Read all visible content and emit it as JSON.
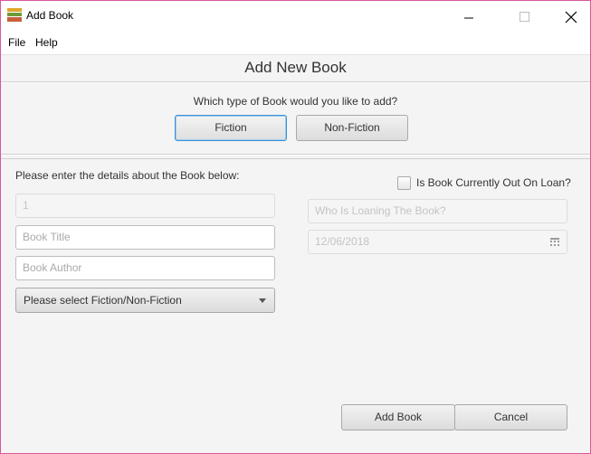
{
  "window": {
    "title": "Add Book"
  },
  "menubar": {
    "items": [
      "File",
      "Help"
    ]
  },
  "header": {
    "title": "Add New Book"
  },
  "type_select": {
    "question": "Which type of Book would you like to add?",
    "fiction_label": "Fiction",
    "nonfiction_label": "Non-Fiction"
  },
  "details": {
    "prompt": "Please enter the details about the Book below:",
    "id_value": "1",
    "title_placeholder": "Book Title",
    "author_placeholder": "Book Author",
    "genre_selected": "Please select Fiction/Non-Fiction"
  },
  "loan": {
    "checkbox_label": "Is Book Currently Out On Loan?",
    "checked": false,
    "borrower_placeholder": "Who Is Loaning The Book?",
    "date_value": "12/06/2018"
  },
  "actions": {
    "add_label": "Add Book",
    "cancel_label": "Cancel"
  },
  "icons": {
    "app": "books-icon",
    "minimize": "minimize-icon",
    "maximize": "maximize-icon",
    "close": "close-icon",
    "calendar": "calendar-icon",
    "dropdown": "chevron-down-icon"
  },
  "colors": {
    "window_border": "#d9579a",
    "focus_ring": "#3d8fd6"
  }
}
